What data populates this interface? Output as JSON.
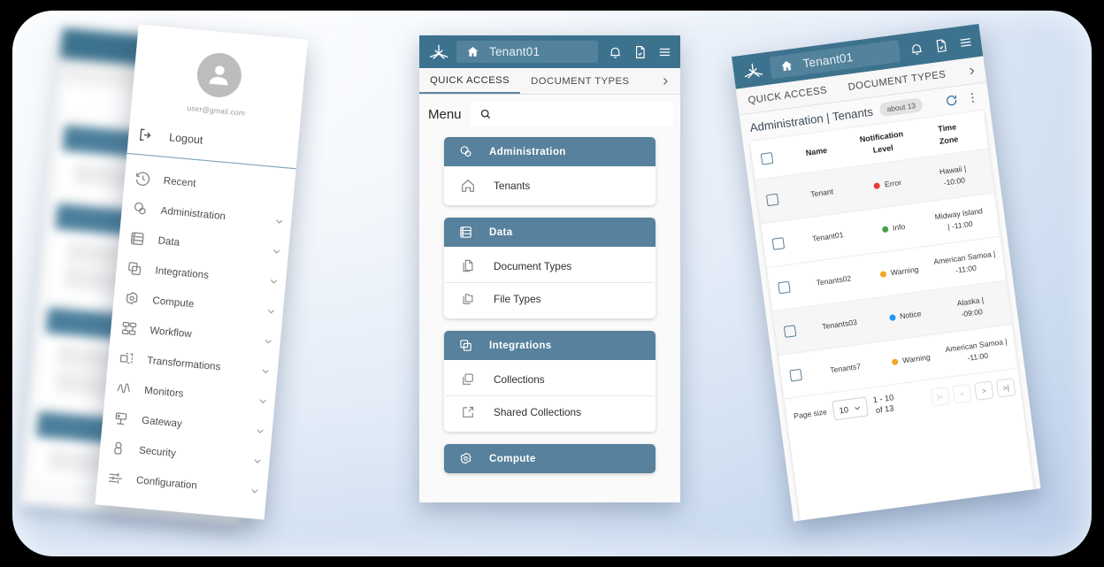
{
  "app": {
    "logo_icon": "converge-arrow-icon",
    "tenant_name": "Tenant01",
    "home_icon": "home-icon",
    "notifications_icon": "bell-icon",
    "documents_icon": "document-check-icon",
    "menu_icon": "hamburger-icon",
    "accent_color": "#3d728e",
    "card_header_color": "#57819c"
  },
  "tabs": {
    "quick_access": "QUICK ACCESS",
    "document_types": "DOCUMENT TYPES",
    "more_icon": "chevron-right-icon"
  },
  "sidebar": {
    "avatar_icon": "user-avatar-icon",
    "email": "user@gmail.com",
    "logout_label": "Logout",
    "logout_icon": "logout-icon",
    "items": [
      {
        "label": "Recent",
        "icon": "history-icon",
        "expandable": false
      },
      {
        "label": "Administration",
        "icon": "admin-badge-icon",
        "expandable": true
      },
      {
        "label": "Data",
        "icon": "database-icon",
        "expandable": true
      },
      {
        "label": "Integrations",
        "icon": "layers-icon",
        "expandable": true
      },
      {
        "label": "Compute",
        "icon": "gear-icon",
        "expandable": true
      },
      {
        "label": "Workflow",
        "icon": "workflow-icon",
        "expandable": true
      },
      {
        "label": "Transformations",
        "icon": "transform-icon",
        "expandable": true
      },
      {
        "label": "Monitors",
        "icon": "pulse-icon",
        "expandable": true
      },
      {
        "label": "Gateway",
        "icon": "gateway-icon",
        "expandable": true
      },
      {
        "label": "Security",
        "icon": "lock-icon",
        "expandable": true
      },
      {
        "label": "Configuration",
        "icon": "sliders-icon",
        "expandable": true
      }
    ]
  },
  "menu_screen": {
    "menu_label": "Menu",
    "search_icon": "search-icon",
    "search_placeholder": "",
    "groups": [
      {
        "title": "Administration",
        "icon": "admin-badge-icon",
        "rows": [
          {
            "label": "Tenants",
            "icon": "home-outline-icon"
          }
        ]
      },
      {
        "title": "Data",
        "icon": "database-icon",
        "rows": [
          {
            "label": "Document Types",
            "icon": "document-copy-icon"
          },
          {
            "label": "File Types",
            "icon": "folder-copy-icon"
          }
        ]
      },
      {
        "title": "Integrations",
        "icon": "layers-icon",
        "rows": [
          {
            "label": "Collections",
            "icon": "copy-icon"
          },
          {
            "label": "Shared Collections",
            "icon": "external-link-icon"
          }
        ]
      },
      {
        "title": "Compute",
        "icon": "gear-icon",
        "rows": []
      }
    ]
  },
  "table_screen": {
    "breadcrumb": "Administration | Tenants",
    "count_badge": "about 13",
    "refresh_icon": "refresh-icon",
    "overflow_icon": "more-vertical-icon",
    "select_all_checkbox": "checkbox-icon",
    "columns": [
      "Name",
      "Notification Level",
      "Time Zone"
    ],
    "column_lines": [
      [
        "Name"
      ],
      [
        "Notification",
        "Level"
      ],
      [
        "Time",
        "Zone"
      ]
    ],
    "rows": [
      {
        "name": "Tenant",
        "level": "Error",
        "level_color": "#e53935",
        "tz_line1": "Hawaii |",
        "tz_line2": "-10:00"
      },
      {
        "name": "Tenant01",
        "level": "Info",
        "level_color": "#43a047",
        "tz_line1": "Midway Island",
        "tz_line2": "| -11:00"
      },
      {
        "name": "Tenants02",
        "level": "Warning",
        "level_color": "#f5a623",
        "tz_line1": "American Samoa |",
        "tz_line2": "-11:00"
      },
      {
        "name": "Tenants03",
        "level": "Notice",
        "level_color": "#2196f3",
        "tz_line1": "Alaska |",
        "tz_line2": "-09:00"
      },
      {
        "name": "Tenants7",
        "level": "Warning",
        "level_color": "#f5a623",
        "tz_line1": "American Samoa |",
        "tz_line2": "-11:00"
      }
    ],
    "paginator": {
      "page_size_label": "Page size",
      "page_size_value": "10",
      "chevron_icon": "chevron-down-icon",
      "range_line1": "1 - 10",
      "range_line2": "of 13",
      "first_label": "|<",
      "prev_label": "<",
      "next_label": ">",
      "last_label": ">|"
    }
  }
}
